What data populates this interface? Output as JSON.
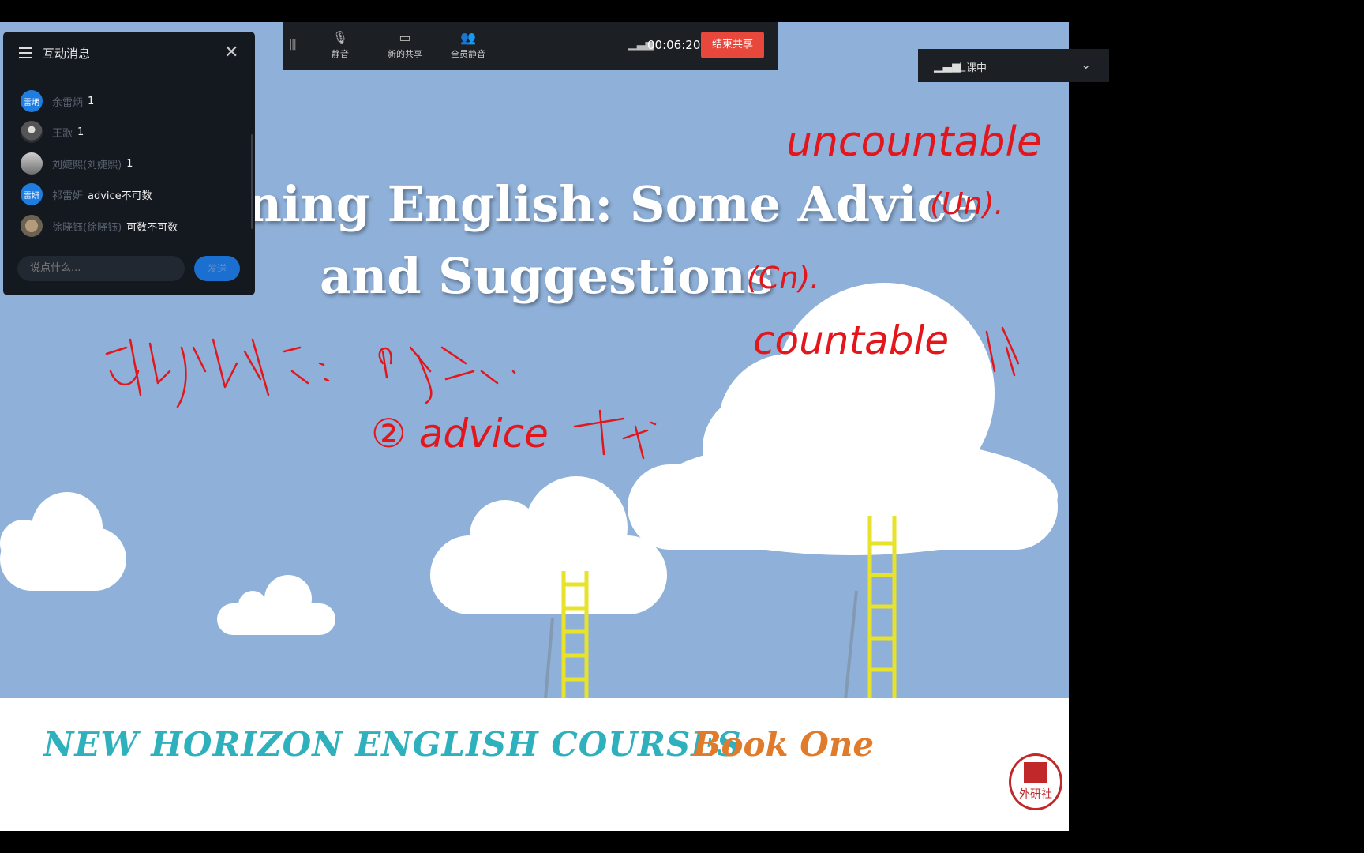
{
  "slide": {
    "title_line1": "ning English: Some Advice",
    "title_line2": "and Suggestions",
    "footer_course": "NEW HORIZON ENGLISH COURSES",
    "footer_book": "Book One",
    "logo_text": "外研社"
  },
  "annotations": {
    "uncountable": "uncountable",
    "un_mark": "(Un).",
    "cn_mark": "(Cn).",
    "countable": "countable",
    "advice_formal": "② advice"
  },
  "chat": {
    "title": "互动消息",
    "messages": [
      {
        "avatar": "雷炳",
        "name": "余雷炳",
        "text": "1"
      },
      {
        "avatar": "",
        "name": "王歌",
        "text": "1"
      },
      {
        "avatar": "",
        "name": "刘婕熙(刘婕熙)",
        "text": "1"
      },
      {
        "avatar": "雷妍",
        "name": "祁雷妍",
        "text": "advice不可数"
      },
      {
        "avatar": "",
        "name": "徐晓钰(徐晓钰)",
        "text": "可数不可数"
      }
    ],
    "input_placeholder": "说点什么...",
    "send_label": "发送"
  },
  "toolbar": {
    "mute_label": "静音",
    "new_share_label": "新的共享",
    "mute_all_label": "全员静音",
    "timer": "00:06:20",
    "end_share_label": "结束共享"
  },
  "status": {
    "label": "上课中"
  }
}
